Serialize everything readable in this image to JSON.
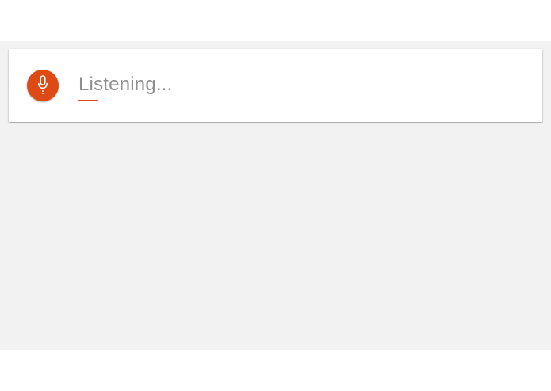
{
  "voice_search": {
    "status_text": "Listening...",
    "mic_icon": "microphone-icon",
    "accent_color": "#dd4a14",
    "text_color": "#8f8f8f",
    "background_color": "#f2f2f2"
  }
}
